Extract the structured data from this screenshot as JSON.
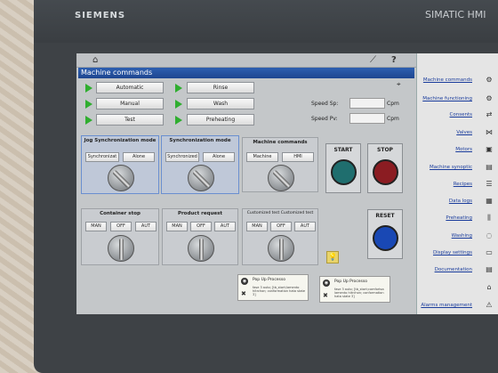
{
  "device": {
    "brand": "SIEMENS",
    "model": "SIMATIC HMI"
  },
  "window": {
    "title": "Machine commands"
  },
  "modes": [
    {
      "label": "Automatic"
    },
    {
      "label": "Manual"
    },
    {
      "label": "Test"
    }
  ],
  "operations": [
    {
      "label": "Rinse"
    },
    {
      "label": "Wash"
    },
    {
      "label": "Preheating"
    }
  ],
  "speed": {
    "sp_label": "Speed Sp:",
    "pv_label": "Speed Pv:",
    "unit": "Cpm",
    "sp_value": "",
    "pv_value": ""
  },
  "panels": {
    "jog": {
      "title": "Jog Synchronization mode",
      "opt1": "Synchronizat",
      "opt2": "Alone"
    },
    "sync": {
      "title": "Synchronization mode",
      "opt1": "Synchronized",
      "opt2": "Alone"
    },
    "machine": {
      "title": "Machine commands",
      "opt1": "Machine",
      "opt2": "HMI"
    },
    "container": {
      "title": "Container stop",
      "opt1": "MAN",
      "opt2": "OFF",
      "opt3": "AUT"
    },
    "product": {
      "title": "Product request",
      "opt1": "MAN",
      "opt2": "OFF",
      "opt3": "AUT"
    },
    "customized": {
      "title": "Customized test Customized test",
      "opt1": "MAN",
      "opt2": "OFF",
      "opt3": "AUT"
    }
  },
  "big_buttons": {
    "start": "START",
    "stop": "STOP",
    "reset": "RESET"
  },
  "colors": {
    "start": "#1f6e6e",
    "stop": "#8b1c22",
    "reset": "#1948b4",
    "accent": "#2e5fb0"
  },
  "popups": [
    {
      "title": "Pop Up Processo",
      "body": "fase 3 auto; [tb_start;lamento hitrchon; conformation hata state 3]"
    },
    {
      "title": "Pop Up Processo",
      "body": "fase 3 auto; [tb_start;comfortsa lamento hitrchon; conformation hata state 3]"
    }
  ],
  "nav": [
    {
      "label": "Machine commands",
      "icon": "gear-icon"
    },
    {
      "label": "Machine functioning",
      "icon": "gears-icon"
    },
    {
      "label": "Consents",
      "icon": "arrows-icon"
    },
    {
      "label": "Valves",
      "icon": "valve-icon"
    },
    {
      "label": "Motors",
      "icon": "motor-icon"
    },
    {
      "label": "Machine synoptic",
      "icon": "synoptic-icon"
    },
    {
      "label": "Recipes",
      "icon": "recipes-icon"
    },
    {
      "label": "Data logs",
      "icon": "datalog-icon"
    },
    {
      "label": "Preheating",
      "icon": "preheat-icon"
    },
    {
      "label": "Washing",
      "icon": "washing-icon"
    },
    {
      "label": "Display settings",
      "icon": "display-icon"
    },
    {
      "label": "Documentation",
      "icon": "doc-icon"
    },
    {
      "label": "",
      "icon": "home-icon"
    },
    {
      "label": "Alarms management",
      "icon": "alarm-icon"
    }
  ]
}
